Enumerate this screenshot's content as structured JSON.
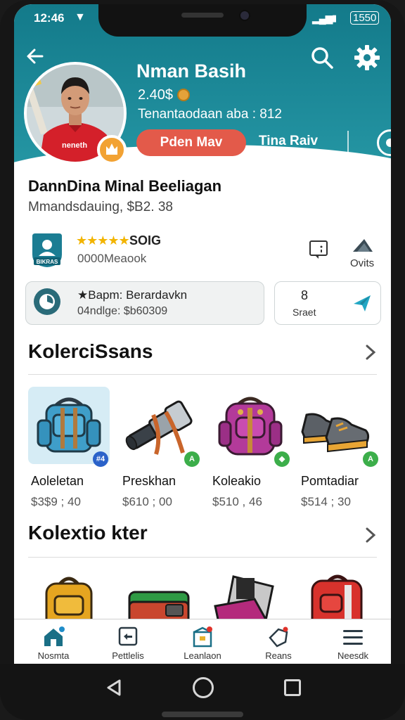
{
  "status_bar": {
    "time": "12:46",
    "battery": "1550"
  },
  "profile": {
    "name": "Nman Basih",
    "points": "2.40$",
    "subtitle": "Tenantaodaan aba : 812",
    "primary_button": "Pden Mav",
    "secondary_button": "Tina Raiv"
  },
  "info": {
    "title": "DannDina Minal Beeliagan",
    "subtitle": "Mmandsdauing, $B2. 38"
  },
  "rating": {
    "stars": "★★★★★",
    "value": "SOIG",
    "sub": "0000Meaook",
    "badge_text": "BIKRAS",
    "outs_label": "Ovits"
  },
  "card_left": {
    "title": "★Bapm: Berardavkn",
    "sub": "04ndlge: $b60309"
  },
  "card_right": {
    "number": "8",
    "label": "Sraet"
  },
  "section1": {
    "title": "KolerciSsans",
    "items": [
      {
        "name": "Aoleletan",
        "price": "$3$9 ; 40",
        "icon": "backpack-icon",
        "tag": "#4"
      },
      {
        "name": "Preskhan",
        "price": "$610 ; 00",
        "icon": "telescope-icon",
        "tag": "A"
      },
      {
        "name": "Koleakio",
        "price": "$510 , 46",
        "icon": "purple-bag-icon",
        "tag": "◆"
      },
      {
        "name": "Pomtadiar",
        "price": "$514 ; 30",
        "icon": "shoes-icon",
        "tag": "A"
      }
    ]
  },
  "section2": {
    "title": "Kolextio kter"
  },
  "bottom_nav": {
    "items": [
      {
        "label": "Nosmta",
        "icon": "home-icon"
      },
      {
        "label": "Pettlelis",
        "icon": "shield-icon"
      },
      {
        "label": "Leanlaon",
        "icon": "shop-icon"
      },
      {
        "label": "Reans",
        "icon": "tag-icon"
      },
      {
        "label": "Neesdk",
        "icon": "menu-icon"
      }
    ]
  },
  "colors": {
    "header": "#1f8d9c",
    "accent_red": "#e35a4a",
    "badge_orange": "#f2a233",
    "star": "#f2b400"
  }
}
